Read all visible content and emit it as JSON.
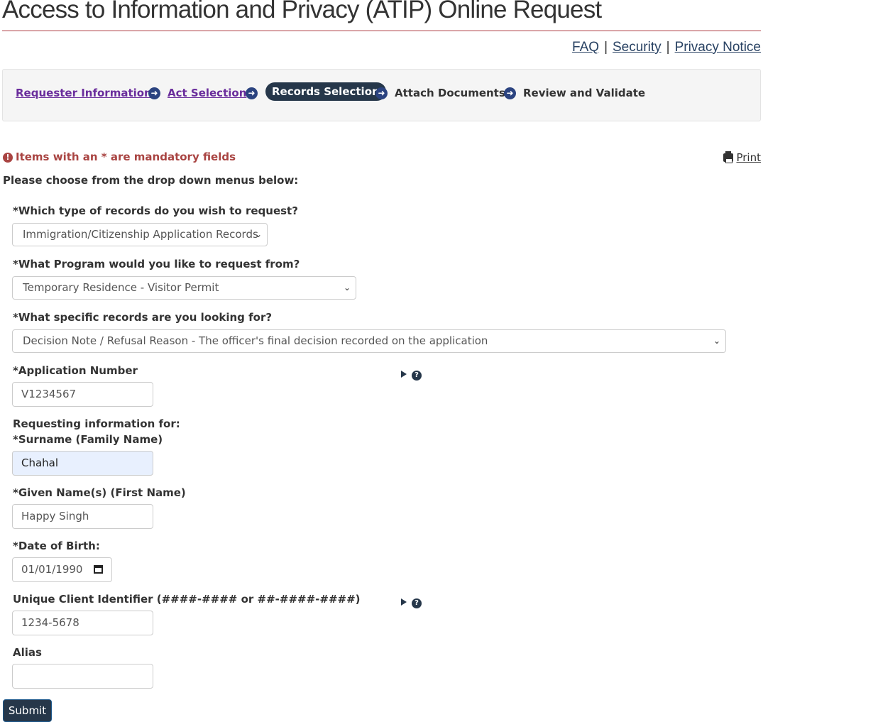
{
  "page": {
    "title": "Access to Information and Privacy (ATIP) Online Request"
  },
  "toplinks": {
    "faq": "FAQ",
    "security": "Security",
    "privacy": "Privacy Notice",
    "separator": "|"
  },
  "steps": [
    {
      "label": "Requester Information",
      "state": "link"
    },
    {
      "label": "Act Selection",
      "state": "link"
    },
    {
      "label": "Records Selection",
      "state": "active"
    },
    {
      "label": "Attach Documents",
      "state": "plain"
    },
    {
      "label": "Review and Validate",
      "state": "plain"
    }
  ],
  "notice": {
    "mandatory": "Items with an * are mandatory fields",
    "print": "Print",
    "instructions": "Please choose from the drop down menus below:"
  },
  "form": {
    "record_type": {
      "label": "*Which type of records do you wish to request?",
      "value": "Immigration/Citizenship Application Records"
    },
    "program": {
      "label": "*What Program would you like to request from?",
      "value": "Temporary Residence - Visitor Permit"
    },
    "specific_records": {
      "label": "*What specific records are you looking for?",
      "value": "Decision Note / Refusal Reason - The officer's final decision recorded on the application"
    },
    "application_number": {
      "label": "*Application Number",
      "value": "V1234567"
    },
    "requesting_for": {
      "label": "Requesting information for:"
    },
    "surname": {
      "label": "*Surname (Family Name)",
      "value": "Chahal"
    },
    "given_names": {
      "label": "*Given Name(s) (First Name)",
      "value": "Happy Singh"
    },
    "dob": {
      "label": "*Date of Birth:",
      "value": "01/01/1990"
    },
    "uci": {
      "label": "Unique Client Identifier (####-#### or ##-####-####)",
      "value": "1234-5678"
    },
    "alias": {
      "label": "Alias",
      "value": ""
    },
    "submit_label": "Submit"
  },
  "colors": {
    "accent": "#26374a",
    "link": "#284162",
    "visited": "#6a2d9c",
    "alert": "#a94442",
    "rule": "#af3c43"
  },
  "icons": {
    "step_arrow": "arrow-circle-right-icon",
    "help": "question-circle-icon",
    "print": "printer-icon",
    "alert": "exclamation-circle-icon"
  }
}
